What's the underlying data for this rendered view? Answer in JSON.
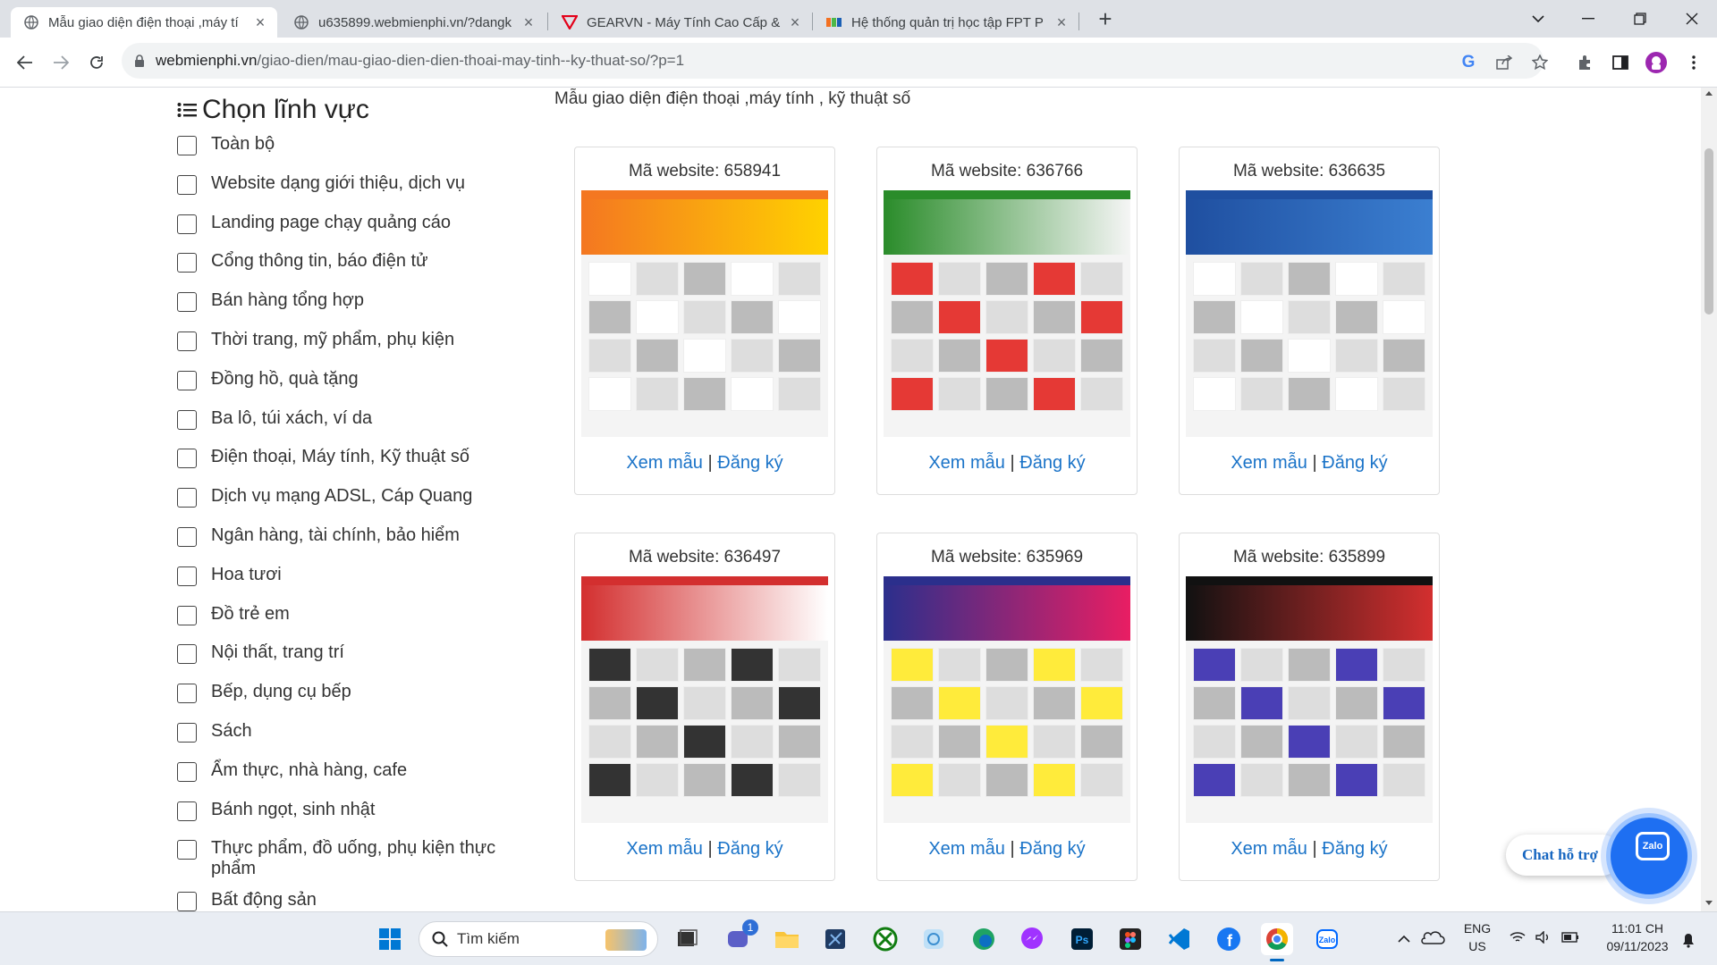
{
  "browser": {
    "tabs": [
      {
        "title": "Mẫu giao diện điện thoại ,máy tí",
        "active": true
      },
      {
        "title": "u635899.webmienphi.vn/?dangk",
        "active": false
      },
      {
        "title": "GEARVN - Máy Tính Cao Cấp &",
        "active": false
      },
      {
        "title": "Hệ thống quản trị học tập FPT P",
        "active": false
      }
    ],
    "url_host": "webmienphi.vn",
    "url_path": "/giao-dien/mau-giao-dien-dien-thoai-may-tinh--ky-thuat-so/?p=1"
  },
  "sidebar": {
    "heading": "Chọn lĩnh vực",
    "items": [
      {
        "label": "Toàn bộ",
        "icon": "list-icon"
      },
      {
        "label": "Website dạng giới thiệu, dịch vụ",
        "icon": "user-icon"
      },
      {
        "label": "Landing page chạy quảng cáo",
        "icon": "newspaper-icon"
      },
      {
        "label": "Cổng thông tin, báo điện tử",
        "icon": "info-icon"
      },
      {
        "label": "Bán hàng tổng hợp",
        "icon": "cart-icon"
      },
      {
        "label": "Thời trang, mỹ phẩm, phụ kiện",
        "icon": "shirt-icon"
      },
      {
        "label": "Đồng hồ, quà tặng",
        "icon": "watch-icon"
      },
      {
        "label": "Ba lô, túi xách, ví da",
        "icon": "bag-icon"
      },
      {
        "label": "Điện thoại, Máy tính, Kỹ thuật số",
        "icon": "monitor-icon"
      },
      {
        "label": "Dịch vụ mạng ADSL, Cáp Quang",
        "icon": "network-icon"
      },
      {
        "label": "Ngân hàng, tài chính, bảo hiểm",
        "icon": "bank-icon"
      },
      {
        "label": "Hoa tươi",
        "icon": "gift-icon"
      },
      {
        "label": "Đồ trẻ em",
        "icon": "stroller-icon"
      },
      {
        "label": "Nội thất, trang trí",
        "icon": "sofa-icon"
      },
      {
        "label": "Bếp, dụng cụ bếp",
        "icon": "kitchen-icon"
      },
      {
        "label": "Sách",
        "icon": "book-icon"
      },
      {
        "label": "Ẩm thực, nhà hàng, cafe",
        "icon": "utensils-icon"
      },
      {
        "label": "Bánh ngọt, sinh nhật",
        "icon": "cake-icon"
      },
      {
        "label": "Thực phẩm, đồ uống, phụ kiện thực phẩm",
        "icon": "food-icon"
      },
      {
        "label": "Bất động sản",
        "icon": "house-icon"
      }
    ]
  },
  "main": {
    "title": "Mẫu giao diện điện thoại ,máy tính , kỹ thuật số",
    "view_label": "Xem mẫu",
    "register_label": "Đăng ký",
    "sep": "|",
    "cards": [
      {
        "code": "Mã website: 658941",
        "theme": [
          "#f47721",
          "#ffd200",
          "#ffffff"
        ]
      },
      {
        "code": "Mã website: 636766",
        "theme": [
          "#2a8c2a",
          "#f5f5f5",
          "#e53935"
        ]
      },
      {
        "code": "Mã website: 636635",
        "theme": [
          "#1f4fa0",
          "#3b7fd1",
          "#ffffff"
        ]
      },
      {
        "code": "Mã website: 636497",
        "theme": [
          "#d32f2f",
          "#ffffff",
          "#333333"
        ]
      },
      {
        "code": "Mã website: 635969",
        "theme": [
          "#2b2f8c",
          "#e91e63",
          "#ffeb3b"
        ]
      },
      {
        "code": "Mã website: 635899",
        "theme": [
          "#111111",
          "#d32f2f",
          "#4a3fb5"
        ]
      }
    ]
  },
  "chat": {
    "label": "Chat hỗ trợ",
    "zalo": "Zalo"
  },
  "taskbar": {
    "search_placeholder": "Tìm kiếm",
    "lang_top": "ENG",
    "lang_bottom": "US",
    "time": "11:01 CH",
    "date": "09/11/2023",
    "teams_badge": "1"
  }
}
